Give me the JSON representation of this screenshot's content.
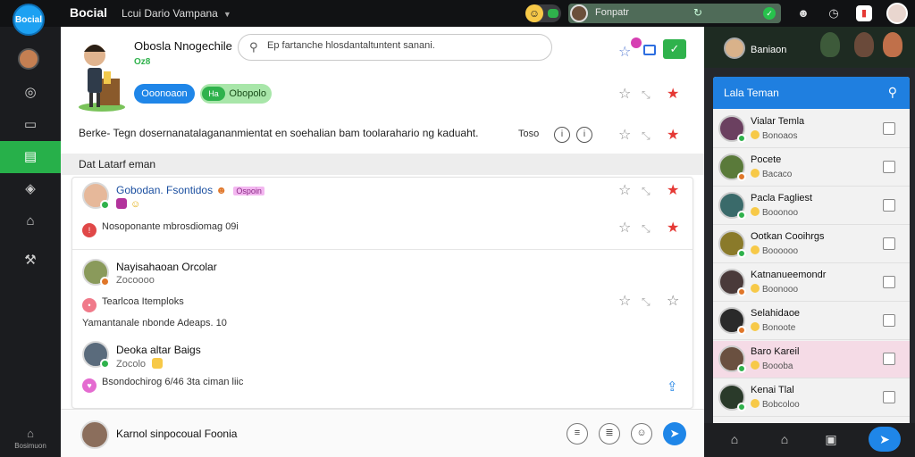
{
  "colors": {
    "accent": "#1f86e8",
    "green": "#2fb24c",
    "star": "#e53935",
    "panel": "#25272b"
  },
  "topbar": {
    "logo_text": "Bocial",
    "app_title": "Bocial",
    "workspace": "Lcui Dario Vampana",
    "user_name": "Fonpatr",
    "icons": [
      "emoji-icon",
      "bell-icon",
      "clock-icon",
      "alert-icon",
      "avatar"
    ]
  },
  "rail": {
    "items": [
      "home-icon",
      "camera-icon",
      "book-icon",
      "feed-icon",
      "puzzle-icon",
      "lock-icon",
      "tool-icon"
    ],
    "footer_label": "Bosimuon"
  },
  "profile": {
    "name": "Obosla Nnogechile",
    "sub": "Oz8",
    "search_placeholder": "Ep fartanche hlosdantaltuntent sanani.",
    "pill_blue": "Ooonoaon",
    "pill_green_tag": "Ha",
    "pill_green": "Obopolo"
  },
  "description": {
    "text": "Berke- Tegn dosernanatalagananmientat en soehalian bam toolarahario ng kaduaht.",
    "time": "Toso"
  },
  "section": {
    "title": "Dat Latarf eman"
  },
  "posts": [
    {
      "name": "Gobodan. Fsontidos",
      "tag": "Ospoin",
      "text": "Nosoponante mbrosdiomag 09i"
    },
    {
      "name": "Nayisahaoan Orcolar",
      "meta": "Zocoooo",
      "tag_line": "Tearlcoa Itemploks",
      "text": "Yamantanale nbonde Adeaps. 10"
    },
    {
      "name": "Deoka altar Baigs",
      "meta": "Zocolo",
      "text": "Bsondochirog 6/46 3ta ciman liic"
    }
  ],
  "composer": {
    "text": "Karnol sinpocoual Foonia"
  },
  "rpanel": {
    "banner_name": "Baniaon",
    "title": "Lala Teman",
    "friends": [
      {
        "name": "Vialar Temla",
        "status": "Bonoaos"
      },
      {
        "name": "Pocete",
        "status": "Bacaco"
      },
      {
        "name": "Pacla Fagliest",
        "status": "Booonoo"
      },
      {
        "name": "Ootkan Cooihrgs",
        "status": "Boooooo"
      },
      {
        "name": "Katnanueemondr",
        "status": "Boonooo"
      },
      {
        "name": "Selahidaoe",
        "status": "Bonoote"
      },
      {
        "name": "Baro Kareil",
        "status": "Boooba"
      },
      {
        "name": "Kenai Tlal",
        "status": "Bobcoloo"
      }
    ]
  }
}
